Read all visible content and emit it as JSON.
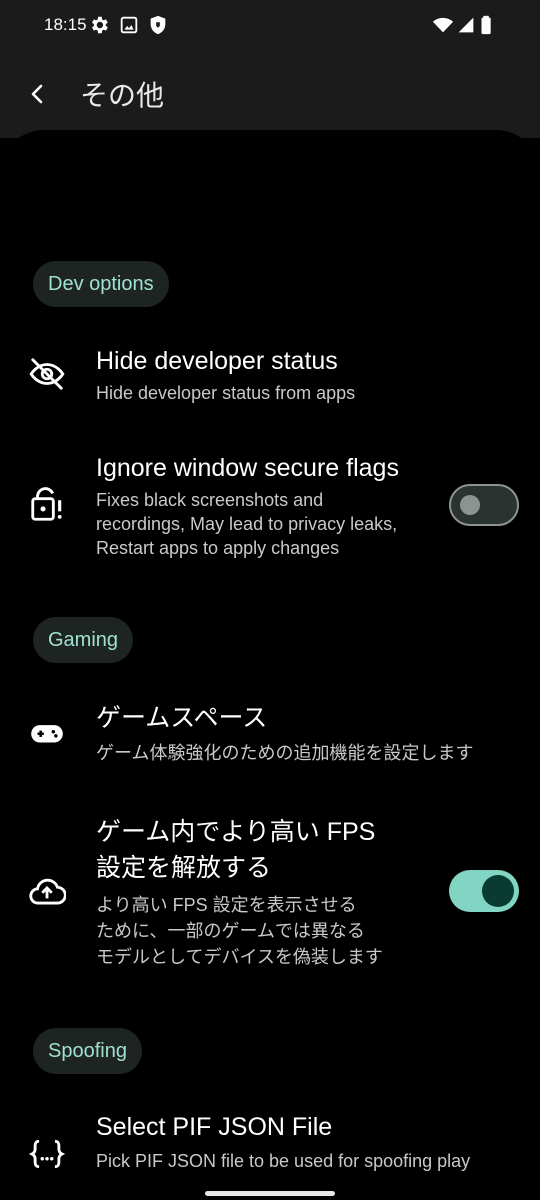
{
  "status_bar": {
    "time": "18:15",
    "icons": [
      "gear-icon",
      "image-icon",
      "shield-icon",
      "wifi-icon",
      "signal-icon",
      "battery-icon"
    ]
  },
  "header": {
    "title": "その他"
  },
  "sections": {
    "dev": {
      "label": "Dev options",
      "items": [
        {
          "title": "Hide developer status",
          "summary": "Hide developer status from apps",
          "icon": "eye-off-icon"
        },
        {
          "title": "Ignore window secure flags",
          "summary_lines": [
            "Fixes black screenshots and",
            "recordings, May lead to privacy leaks,",
            "Restart apps to apply changes"
          ],
          "icon": "lock-alert-icon",
          "toggle_on": false
        }
      ]
    },
    "gaming": {
      "label": "Gaming",
      "items": [
        {
          "title": "ゲームスペース",
          "summary": "ゲーム体験強化のための追加機能を設定します",
          "icon": "gamepad-icon"
        },
        {
          "title_lines": [
            "ゲーム内でより高い FPS",
            "設定を解放する"
          ],
          "summary_lines": [
            "より高い FPS 設定を表示させる",
            "ために、一部のゲームでは異なる",
            "モデルとしてデバイスを偽装します"
          ],
          "icon": "cloud-upload-icon",
          "toggle_on": true
        }
      ]
    },
    "spoofing": {
      "label": "Spoofing",
      "items": [
        {
          "title": "Select PIF JSON File",
          "summary": "Pick PIF JSON file to be used for spoofing play",
          "icon": "json-braces-icon"
        }
      ]
    }
  },
  "colors": {
    "accent": "#83d5c3",
    "chip_bg": "#1e2422",
    "chip_text": "#9fe1d0",
    "bar_bg": "#1b1b1b"
  }
}
